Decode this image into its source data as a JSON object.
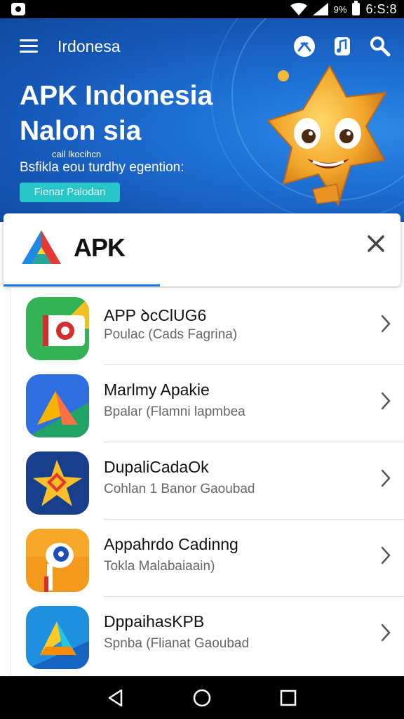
{
  "status_bar": {
    "time": "6:S:8",
    "battery_text": "9%"
  },
  "header": {
    "location": "Irdonesa"
  },
  "hero": {
    "title_line1": "APK Indonesia",
    "title_line2": "Nalon sia",
    "subtitle_small": "cail lkocihcn",
    "subtitle": "Bsfikla eou turdhy egention:",
    "button_label": "Fienar Palodan"
  },
  "search": {
    "value": "APK"
  },
  "apps": [
    {
      "title": "APP ꝺᴄClUG6",
      "subtitle": "Poulac (Cads Fagrina)",
      "icon": "app-one-icon"
    },
    {
      "title": "Marlmy Apakie",
      "subtitle": "Bpalar (Flamni lapmbea",
      "icon": "app-two-icon"
    },
    {
      "title": "DupaliCadaOk",
      "subtitle": "Cohlan 1 Banor Gaoubad",
      "icon": "app-three-icon"
    },
    {
      "title": "Appahrdo Cadinng",
      "subtitle": "Tokla Malabaiaain)",
      "icon": "app-four-icon"
    },
    {
      "title": "DppaihasKPB",
      "subtitle": "Spnba (Flianat Gaoubad",
      "icon": "app-five-icon"
    }
  ],
  "colors": {
    "accent": "#1a73e8",
    "hero_blue": "#1556b5",
    "teal_button": "#29c6c9"
  }
}
